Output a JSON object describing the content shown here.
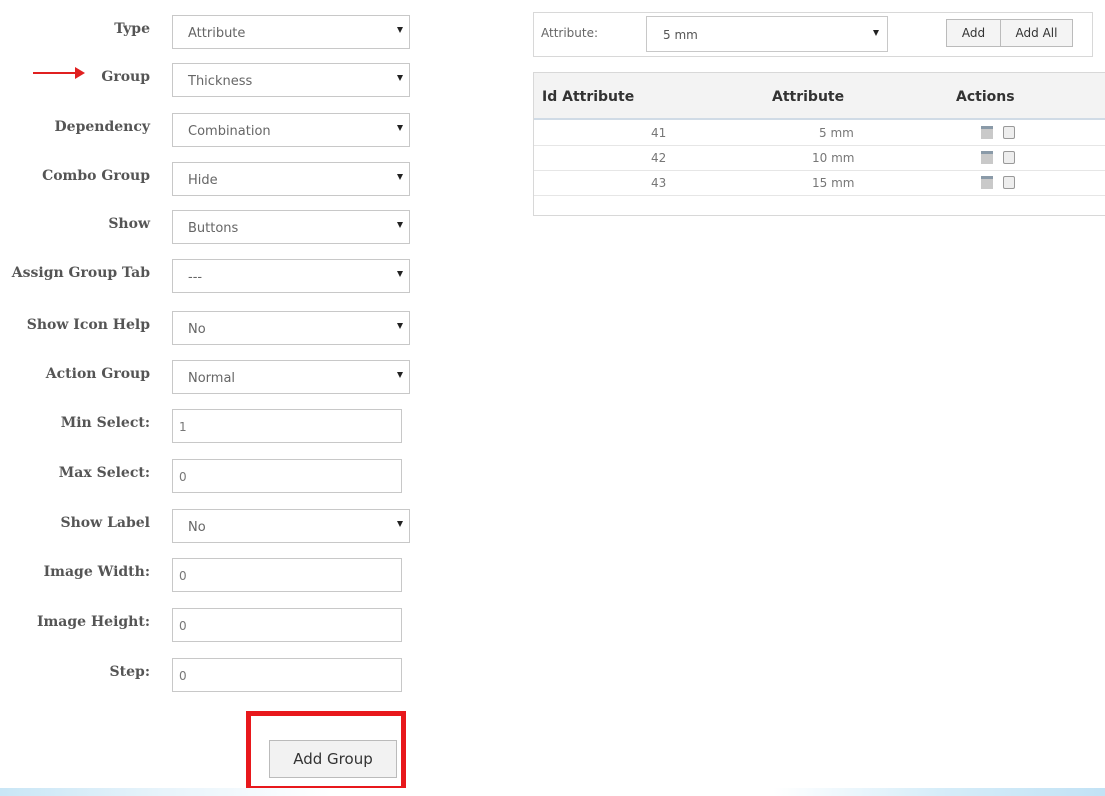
{
  "form": {
    "rows": [
      {
        "label": "Type",
        "value": "Attribute",
        "kind": "select"
      },
      {
        "label": "Group",
        "value": "Thickness",
        "kind": "select"
      },
      {
        "label": "Dependency",
        "value": "Combination",
        "kind": "select"
      },
      {
        "label": "Combo Group",
        "value": "Hide",
        "kind": "select"
      },
      {
        "label": "Show",
        "value": "Buttons",
        "kind": "select"
      },
      {
        "label": "Assign Group Tab",
        "value": "---",
        "kind": "select"
      },
      {
        "label": "Show Icon Help",
        "value": "No",
        "kind": "select"
      },
      {
        "label": "Action Group",
        "value": "Normal",
        "kind": "select"
      },
      {
        "label": "Min Select:",
        "value": "1",
        "kind": "input"
      },
      {
        "label": "Max Select:",
        "value": "0",
        "kind": "input"
      },
      {
        "label": "Show Label",
        "value": "No",
        "kind": "select"
      },
      {
        "label": "Image Width:",
        "value": "0",
        "kind": "input"
      },
      {
        "label": "Image Height:",
        "value": "0",
        "kind": "input"
      },
      {
        "label": "Step:",
        "value": "0",
        "kind": "input"
      }
    ],
    "submit_label": "Add Group"
  },
  "attribute_bar": {
    "label": "Attribute:",
    "selected": "5 mm",
    "add_label": "Add",
    "add_all_label": "Add All"
  },
  "attribute_table": {
    "headers": [
      "Id Attribute",
      "Attribute",
      "Actions"
    ],
    "rows": [
      {
        "id": "41",
        "attribute": "5 mm"
      },
      {
        "id": "42",
        "attribute": "10 mm"
      },
      {
        "id": "43",
        "attribute": "15 mm"
      }
    ]
  },
  "colors": {
    "highlight": "#e8181c",
    "arrow": "#e02020"
  },
  "icons": [
    "chevron-down-icon",
    "edit-icon",
    "delete-icon",
    "arrow-right-icon"
  ]
}
